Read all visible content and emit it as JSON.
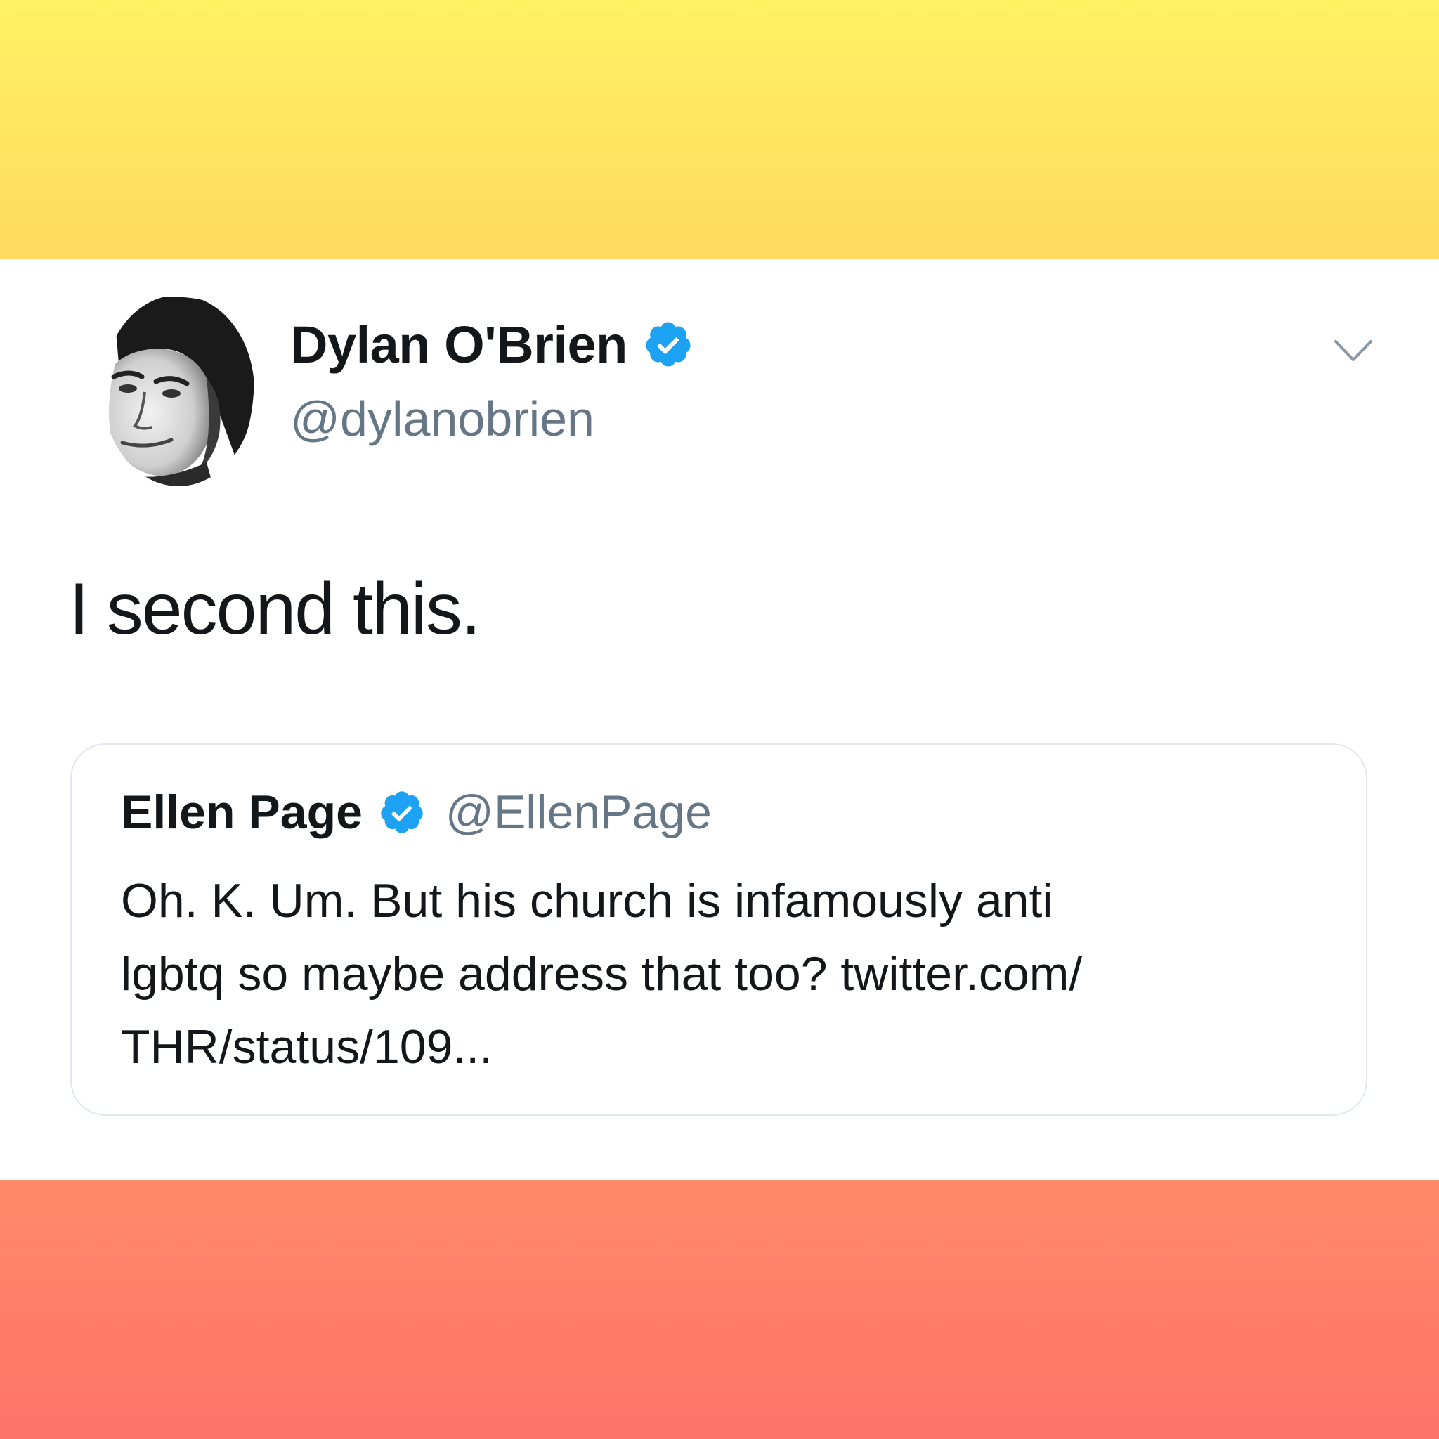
{
  "colors": {
    "top_band": "#ffe95f",
    "bottom_band": "#ff7f6a",
    "verified_blue": "#1da1f2",
    "secondary_text": "#657786"
  },
  "tweet": {
    "author": {
      "name": "Dylan O'Brien",
      "handle": "@dylanobrien",
      "verified": true,
      "avatar_icon": "portrait-avatar"
    },
    "menu_icon": "chevron-down-icon",
    "text": "I second this.",
    "quoted_tweet": {
      "name": "Ellen Page",
      "handle": "@EllenPage",
      "verified": true,
      "lines": [
        "Oh. K. Um. But his church is infamously anti",
        "lgbtq so maybe address that too? twitter.com/",
        "THR/status/109..."
      ]
    }
  }
}
